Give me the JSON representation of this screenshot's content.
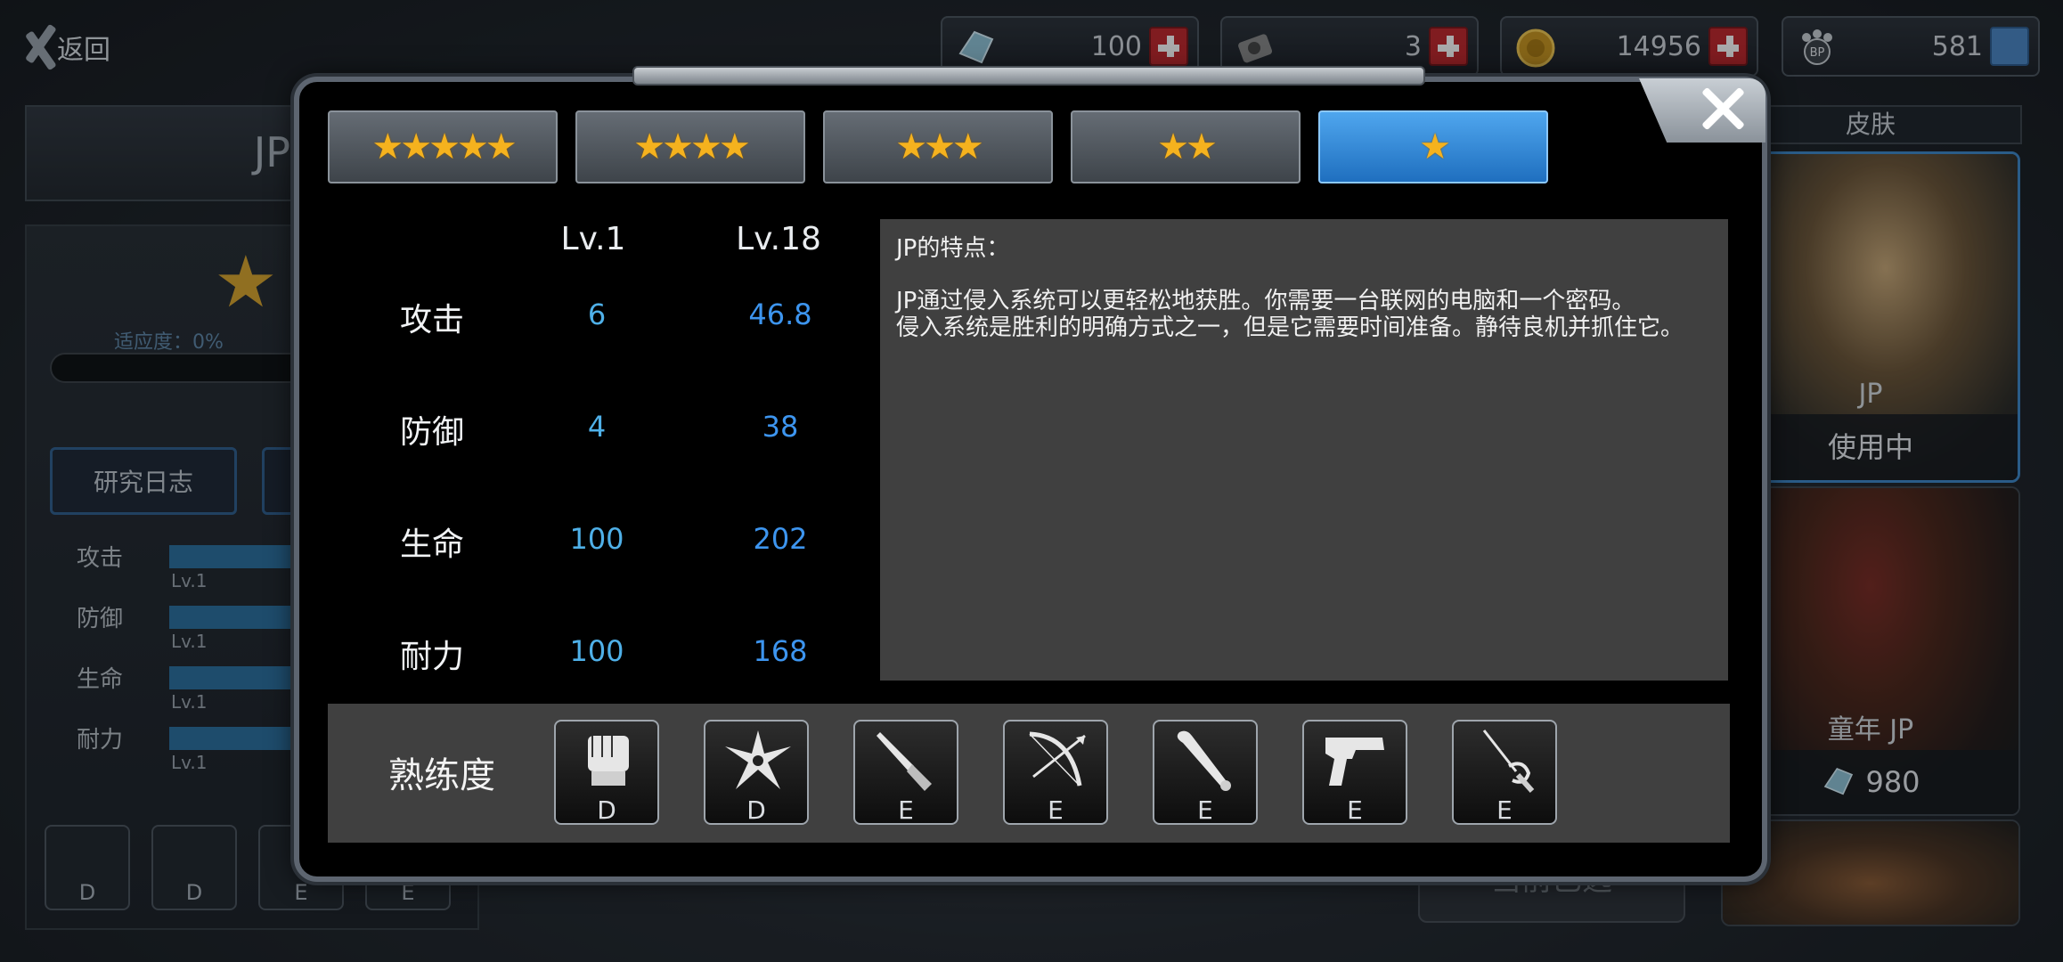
{
  "topbar": {
    "back_label": "返回",
    "currencies": [
      {
        "icon": "crystal-icon",
        "value": "100"
      },
      {
        "icon": "hard-drive-icon",
        "value": "3"
      },
      {
        "icon": "gold-coin-icon",
        "value": "14956"
      },
      {
        "icon": "bp-paw-icon",
        "value": "581"
      }
    ]
  },
  "background": {
    "character_name": "JP",
    "adaptability": "适应度：0%",
    "tabs": [
      "研究日志"
    ],
    "stats": [
      {
        "label": "攻击",
        "level": "Lv.1"
      },
      {
        "label": "防御",
        "level": "Lv.1"
      },
      {
        "label": "生命",
        "level": "Lv.1"
      },
      {
        "label": "耐力",
        "level": "Lv.1"
      }
    ],
    "skill_grades": [
      "D",
      "D",
      "E",
      "E"
    ],
    "skin_header": "皮肤",
    "skins": [
      {
        "name": "JP",
        "status": "使用中"
      },
      {
        "name": "童年 JP",
        "price": "980"
      }
    ],
    "select_button": "当前已选"
  },
  "modal": {
    "star_tabs": [
      {
        "stars": "★★★★★",
        "active": false
      },
      {
        "stars": "★★★★",
        "active": false
      },
      {
        "stars": "★★★",
        "active": false
      },
      {
        "stars": "★★",
        "active": false
      },
      {
        "stars": "★",
        "active": true
      }
    ],
    "stats_table": {
      "col_lv1": "Lv.1",
      "col_lv18": "Lv.18",
      "rows": [
        {
          "label": "攻击",
          "lv1": "6",
          "lv18": "46.8"
        },
        {
          "label": "防御",
          "lv1": "4",
          "lv18": "38"
        },
        {
          "label": "生命",
          "lv1": "100",
          "lv18": "202"
        },
        {
          "label": "耐力",
          "lv1": "100",
          "lv18": "168"
        }
      ]
    },
    "description": {
      "title": "JP的特点：",
      "text": "JP通过侵入系统可以更轻松地获胜。你需要一台联网的电脑和一个密码。\n侵入系统是胜利的明确方式之一，但是它需要时间准备。静待良机并抓住它。"
    },
    "proficiency": {
      "label": "熟练度",
      "weapons": [
        {
          "icon": "fist-icon",
          "grade": "D"
        },
        {
          "icon": "shuriken-icon",
          "grade": "D"
        },
        {
          "icon": "knife-icon",
          "grade": "E"
        },
        {
          "icon": "bow-icon",
          "grade": "E"
        },
        {
          "icon": "bat-icon",
          "grade": "E"
        },
        {
          "icon": "pistol-icon",
          "grade": "E"
        },
        {
          "icon": "rapier-icon",
          "grade": "E"
        }
      ]
    }
  }
}
